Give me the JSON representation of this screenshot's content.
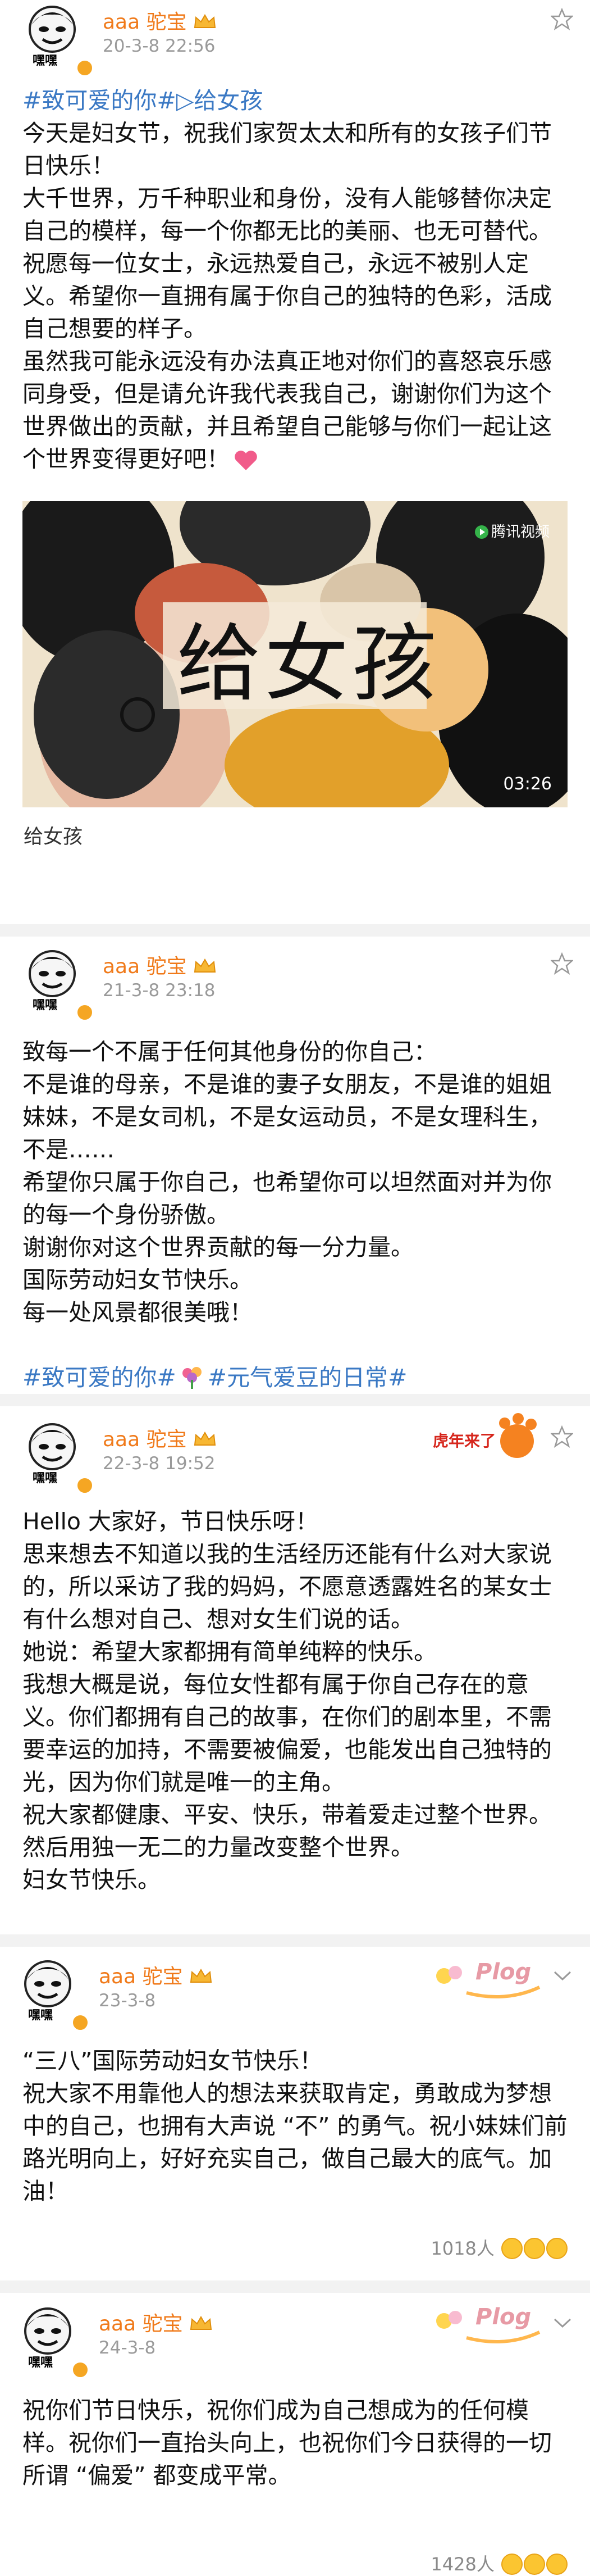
{
  "colors": {
    "username": "#f07a1a",
    "link": "#3b79c4",
    "meta": "#9a9a9a",
    "separator": "#f2f2f2"
  },
  "posts": [
    {
      "author": "aaa 驼宝",
      "avatar_label": "嘿嘿",
      "date": "20-3-8 22:56",
      "tag_line": "#致可爱的你#▷给女孩",
      "lines": [
        "今天是妇女节，祝我们家贺太太和所有的女孩子们节日快乐！",
        "大千世界，万千种职业和身份，没有人能够替你决定自己的模样，每一个你都无比的美丽、也无可替代。",
        "祝愿每一位女士，永远热爱自己，永远不被别人定义。希望你一直拥有属于你自己的独特的色彩，活成自己想要的样子。",
        "虽然我可能永远没有办法真正地对你们的喜怒哀乐感同身受，但是请允许我代表我自己，谢谢你们为这个世界做出的贡献，并且希望自己能够与你们一起让这个世界变得更好吧！"
      ],
      "video": {
        "title": "给女孩",
        "source": "腾讯视频",
        "duration": "03:26",
        "caption": "给女孩"
      }
    },
    {
      "author": "aaa 驼宝",
      "avatar_label": "嘿嘿",
      "date": "21-3-8 23:18",
      "lines": [
        "致每一个不属于任何其他身份的你自己：",
        "不是谁的母亲，不是谁的妻子女朋友，不是谁的姐姐妹妹，不是女司机，不是女运动员，不是女理科生，不是……",
        "希望你只属于你自己，也希望你可以坦然面对并为你的每一个身份骄傲。",
        "谢谢你对这个世界贡献的每一分力量。",
        "国际劳动妇女节快乐。",
        "每一处风景都很美哦！"
      ],
      "tags": [
        "#致可爱的你#",
        "#元气爱豆的日常#"
      ]
    },
    {
      "author": "aaa 驼宝",
      "avatar_label": "嘿嘿",
      "date": "22-3-8 19:52",
      "sticker": "虎年来了",
      "lines": [
        "Hello 大家好，节日快乐呀！",
        "思来想去不知道以我的生活经历还能有什么对大家说的，所以采访了我的妈妈，不愿意透露姓名的某女士有什么想对自己、想对女生们说的话。",
        "她说：希望大家都拥有简单纯粹的快乐。",
        "我想大概是说，每位女性都有属于你自己存在的意义。你们都拥有自己的故事，在你们的剧本里，不需要幸运的加持，不需要被偏爱，也能发出自己独特的光，因为你们就是唯一的主角。",
        "祝大家都健康、平安、快乐，带着爱走过整个世界。然后用独一无二的力量改变整个世界。",
        "妇女节快乐。"
      ]
    },
    {
      "author": "aaa 驼宝",
      "avatar_label": "嘿嘿",
      "date": "23-3-8",
      "sticker": "Plog",
      "lines": [
        "“三八”国际劳动妇女节快乐！",
        "祝大家不用靠他人的想法来获取肯定，勇敢成为梦想中的自己，也拥有大声说 “不” 的勇气。祝小妹妹们前路光明向上，好好充实自己，做自己最大的底气。加油！"
      ],
      "likes": "1018人"
    },
    {
      "author": "aaa 驼宝",
      "avatar_label": "嘿嘿",
      "date": "24-3-8",
      "sticker": "Plog",
      "lines": [
        "祝你们节日快乐，祝你们成为自己想成为的任何模样。祝你们一直抬头向上，也祝你们今日获得的一切所谓 “偏爱” 都变成平常。"
      ],
      "likes": "1428人"
    }
  ]
}
